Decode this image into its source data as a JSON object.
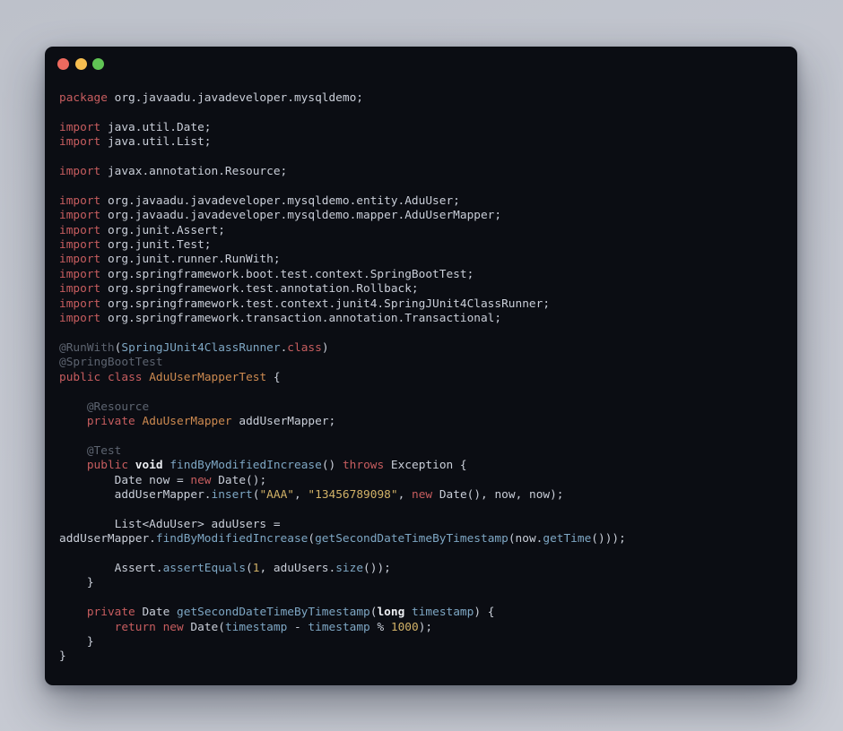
{
  "window": {
    "background": "#0b0d13",
    "traffic_lights": [
      {
        "name": "close",
        "color": "#ee6a5f"
      },
      {
        "name": "minimize",
        "color": "#f6be50"
      },
      {
        "name": "zoom",
        "color": "#60c454"
      }
    ]
  },
  "page_background": "#c4c8d1",
  "colors": {
    "kw": "#c75d5f",
    "ann": "#5d6470",
    "type": "#cd8a50",
    "fn": "#7ea7c4",
    "str": "#d2b267",
    "num": "#d2b267",
    "pln": "#c9ced8",
    "wb": "#eceef2"
  },
  "code": {
    "language": "java",
    "lines": [
      [
        [
          "kw",
          "package"
        ],
        [
          "pln",
          " org.javaadu.javadeveloper.mysqldemo;"
        ]
      ],
      [],
      [
        [
          "kw",
          "import"
        ],
        [
          "pln",
          " java.util.Date;"
        ]
      ],
      [
        [
          "kw",
          "import"
        ],
        [
          "pln",
          " java.util.List;"
        ]
      ],
      [],
      [
        [
          "kw",
          "import"
        ],
        [
          "pln",
          " javax.annotation.Resource;"
        ]
      ],
      [],
      [
        [
          "kw",
          "import"
        ],
        [
          "pln",
          " org.javaadu.javadeveloper.mysqldemo.entity.AduUser;"
        ]
      ],
      [
        [
          "kw",
          "import"
        ],
        [
          "pln",
          " org.javaadu.javadeveloper.mysqldemo.mapper.AduUserMapper;"
        ]
      ],
      [
        [
          "kw",
          "import"
        ],
        [
          "pln",
          " org.junit.Assert;"
        ]
      ],
      [
        [
          "kw",
          "import"
        ],
        [
          "pln",
          " org.junit.Test;"
        ]
      ],
      [
        [
          "kw",
          "import"
        ],
        [
          "pln",
          " org.junit.runner.RunWith;"
        ]
      ],
      [
        [
          "kw",
          "import"
        ],
        [
          "pln",
          " org.springframework.boot.test.context.SpringBootTest;"
        ]
      ],
      [
        [
          "kw",
          "import"
        ],
        [
          "pln",
          " org.springframework.test.annotation.Rollback;"
        ]
      ],
      [
        [
          "kw",
          "import"
        ],
        [
          "pln",
          " org.springframework.test.context.junit4.SpringJUnit4ClassRunner;"
        ]
      ],
      [
        [
          "kw",
          "import"
        ],
        [
          "pln",
          " org.springframework.transaction.annotation.Transactional;"
        ]
      ],
      [],
      [
        [
          "ann",
          "@RunWith"
        ],
        [
          "pln",
          "("
        ],
        [
          "fn",
          "SpringJUnit4ClassRunner"
        ],
        [
          "pln",
          "."
        ],
        [
          "kw",
          "class"
        ],
        [
          "pln",
          ")"
        ]
      ],
      [
        [
          "ann",
          "@SpringBootTest"
        ]
      ],
      [
        [
          "kw",
          "public"
        ],
        [
          "pln",
          " "
        ],
        [
          "kw",
          "class"
        ],
        [
          "pln",
          " "
        ],
        [
          "type",
          "AduUserMapperTest"
        ],
        [
          "pln",
          " {"
        ]
      ],
      [],
      [
        [
          "pln",
          "    "
        ],
        [
          "ann",
          "@Resource"
        ]
      ],
      [
        [
          "pln",
          "    "
        ],
        [
          "kw",
          "private"
        ],
        [
          "pln",
          " "
        ],
        [
          "type",
          "AduUserMapper"
        ],
        [
          "pln",
          " addUserMapper;"
        ]
      ],
      [],
      [
        [
          "pln",
          "    "
        ],
        [
          "ann",
          "@Test"
        ]
      ],
      [
        [
          "pln",
          "    "
        ],
        [
          "kw",
          "public"
        ],
        [
          "pln",
          " "
        ],
        [
          "wb",
          "void"
        ],
        [
          "pln",
          " "
        ],
        [
          "fn",
          "findByModifiedIncrease"
        ],
        [
          "pln",
          "() "
        ],
        [
          "kw",
          "throws"
        ],
        [
          "pln",
          " Exception {"
        ]
      ],
      [
        [
          "pln",
          "        Date now = "
        ],
        [
          "kw",
          "new"
        ],
        [
          "pln",
          " Date();"
        ]
      ],
      [
        [
          "pln",
          "        addUserMapper."
        ],
        [
          "fn",
          "insert"
        ],
        [
          "pln",
          "("
        ],
        [
          "str",
          "\"AAA\""
        ],
        [
          "pln",
          ", "
        ],
        [
          "str",
          "\"13456789098\""
        ],
        [
          "pln",
          ", "
        ],
        [
          "kw",
          "new"
        ],
        [
          "pln",
          " Date(), now, now);"
        ]
      ],
      [],
      [
        [
          "pln",
          "        List<AduUser> aduUsers ="
        ]
      ],
      [
        [
          "pln",
          "addUserMapper."
        ],
        [
          "fn",
          "findByModifiedIncrease"
        ],
        [
          "pln",
          "("
        ],
        [
          "fn",
          "getSecondDateTimeByTimestamp"
        ],
        [
          "pln",
          "(now."
        ],
        [
          "fn",
          "getTime"
        ],
        [
          "pln",
          "()));"
        ]
      ],
      [],
      [
        [
          "pln",
          "        Assert."
        ],
        [
          "fn",
          "assertEquals"
        ],
        [
          "pln",
          "("
        ],
        [
          "num",
          "1"
        ],
        [
          "pln",
          ", aduUsers."
        ],
        [
          "fn",
          "size"
        ],
        [
          "pln",
          "());"
        ]
      ],
      [
        [
          "pln",
          "    }"
        ]
      ],
      [],
      [
        [
          "pln",
          "    "
        ],
        [
          "kw",
          "private"
        ],
        [
          "pln",
          " Date "
        ],
        [
          "fn",
          "getSecondDateTimeByTimestamp"
        ],
        [
          "pln",
          "("
        ],
        [
          "wb",
          "long"
        ],
        [
          "pln",
          " "
        ],
        [
          "fn",
          "timestamp"
        ],
        [
          "pln",
          ") {"
        ]
      ],
      [
        [
          "pln",
          "        "
        ],
        [
          "kw",
          "return"
        ],
        [
          "pln",
          " "
        ],
        [
          "kw",
          "new"
        ],
        [
          "pln",
          " Date("
        ],
        [
          "fn",
          "timestamp"
        ],
        [
          "pln",
          " - "
        ],
        [
          "fn",
          "timestamp"
        ],
        [
          "pln",
          " % "
        ],
        [
          "num",
          "1000"
        ],
        [
          "pln",
          ");"
        ]
      ],
      [
        [
          "pln",
          "    }"
        ]
      ],
      [
        [
          "pln",
          "}"
        ]
      ]
    ]
  }
}
